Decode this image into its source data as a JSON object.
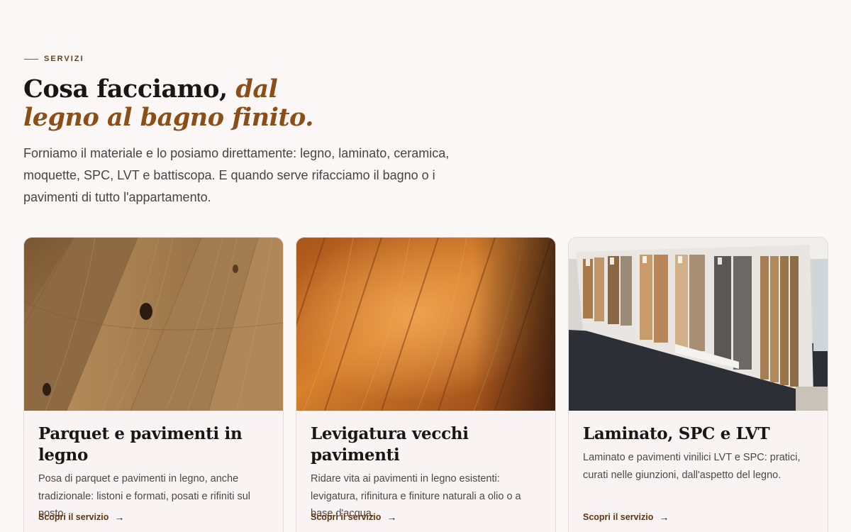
{
  "section": {
    "eyebrow": "SERVIZI",
    "headline_plain": "Cosa facciamo, ",
    "headline_accent_1": "dal",
    "headline_accent_2": "legno al bagno finito.",
    "intro": "Forniamo il materiale e lo posiamo direttamente: legno, laminato, ceramica, moquette, SPC, LVT e battiscopa. E quando serve rifacciamo il bagno o i pavimenti di tutto l'appartamento."
  },
  "colors": {
    "background": "#fbf7f6",
    "accent": "#8b4e16",
    "link": "#5d3510"
  },
  "cards": [
    {
      "image": "oak-parquet-floor-photo",
      "title": "Parquet e pavimenti in legno",
      "description": "Posa di parquet e pavimenti in legno, anche tradizionale: listoni e formati, posati e rifiniti sul posto.",
      "cta": "Scopri il servizio",
      "cta_icon": "arrow-right-icon"
    },
    {
      "image": "sanded-wood-floor-photo",
      "title": "Levigatura vecchi pavimenti",
      "description": "Ridare vita ai pavimenti in legno esistenti: levigatura, rifinitura e finiture naturali a olio o a base d'acqua.",
      "cta": "Scopri il servizio",
      "cta_icon": "arrow-right-icon"
    },
    {
      "image": "laminate-showroom-display-photo",
      "title": "Laminato, SPC e LVT",
      "description": "Laminato e pavimenti vinilici LVT e SPC: pratici, curati nelle giunzioni, dall'aspetto del legno.",
      "cta": "Scopri il servizio",
      "cta_icon": "arrow-right-icon"
    }
  ]
}
